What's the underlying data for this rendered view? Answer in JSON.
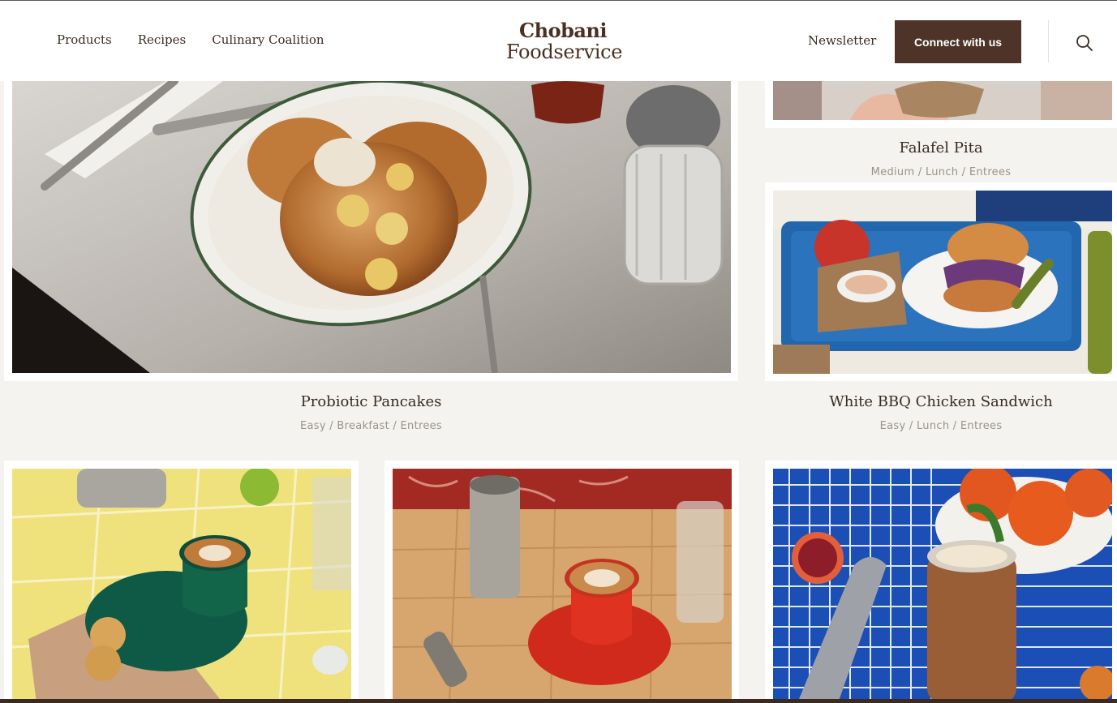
{
  "header": {
    "nav_left": [
      "Products",
      "Recipes",
      "Culinary Coalition"
    ],
    "logo_brand": "Chobani",
    "logo_sub": "Foodservice",
    "newsletter": "Newsletter",
    "connect_label": "Connect with us",
    "search_icon": "search-icon"
  },
  "recipes": [
    {
      "title": "Probiotic Pancakes",
      "tags": "Easy / Breakfast / Entrees"
    },
    {
      "title": "Falafel Pita",
      "tags": "Medium / Lunch / Entrees"
    },
    {
      "title": "White BBQ Chicken Sandwich",
      "tags": "Easy / Lunch / Entrees"
    }
  ],
  "colors": {
    "accent": "#4e3328",
    "page_bg": "#f4f3ef",
    "text": "#3b2a22",
    "tag_text": "#9b938a"
  }
}
